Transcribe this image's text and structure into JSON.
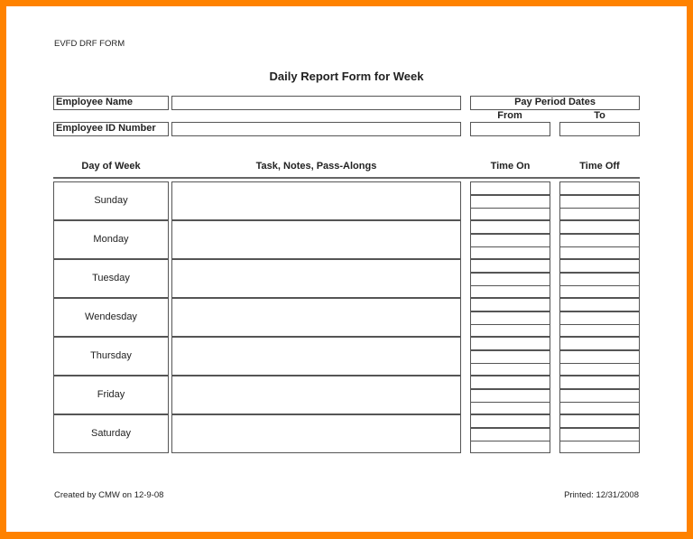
{
  "form_id": "EVFD DRF FORM",
  "title": "Daily Report Form for Week",
  "fields": {
    "employee_name_label": "Employee Name",
    "employee_name_value": "",
    "employee_id_label": "Employee ID Number",
    "employee_id_value": "",
    "pay_period_label": "Pay Period Dates",
    "from_label": "From",
    "to_label": "To",
    "from_value": "",
    "to_value": ""
  },
  "table": {
    "headers": {
      "day": "Day of Week",
      "task": "Task, Notes, Pass-Alongs",
      "time_on": "Time On",
      "time_off": "Time Off"
    },
    "days": [
      "Sunday",
      "Monday",
      "Tuesday",
      "Wendesday",
      "Thursday",
      "Friday",
      "Saturday"
    ],
    "time_slots_per_day": 3
  },
  "footer": {
    "created": "Created by CMW on 12-9-08",
    "printed": "Printed: 12/31/2008"
  },
  "colors": {
    "frame": "#ff8200",
    "line": "#555555"
  }
}
